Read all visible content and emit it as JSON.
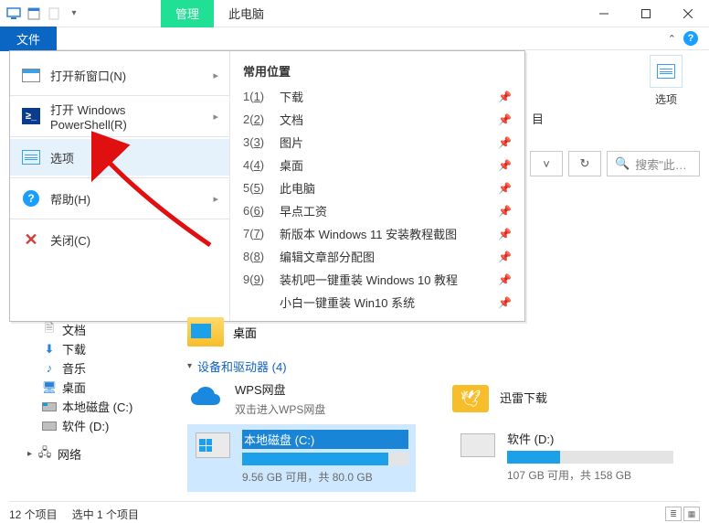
{
  "titlebar": {
    "tab_manage": "管理",
    "tab_thispc": "此电脑"
  },
  "ribbon": {
    "file_tab": "文件",
    "options_tile_label": "选项"
  },
  "remnant_label": "目",
  "search": {
    "placeholder": "搜索\"此…"
  },
  "file_menu": {
    "left": {
      "new_window": "打开新窗口(N)",
      "powershell": "打开 Windows PowerShell(R)",
      "options": "选项",
      "help": "帮助(H)",
      "close": "关闭(C)"
    },
    "right_heading": "常用位置",
    "locations": [
      {
        "num": "1",
        "label": "下载"
      },
      {
        "num": "2",
        "label": "文档"
      },
      {
        "num": "3",
        "label": "图片"
      },
      {
        "num": "4",
        "label": "桌面"
      },
      {
        "num": "5",
        "label": "此电脑"
      },
      {
        "num": "6",
        "label": "早点工资"
      },
      {
        "num": "7",
        "label": "新版本 Windows 11 安装教程截图"
      },
      {
        "num": "8",
        "label": "编辑文章部分配图"
      },
      {
        "num": "9",
        "label": "装机吧一键重装 Windows 10 教程"
      },
      {
        "num": "",
        "label": "小白一键重装 Win10 系统"
      }
    ]
  },
  "sidebar": {
    "items": [
      {
        "label": "文档"
      },
      {
        "label": "下载"
      },
      {
        "label": "音乐"
      },
      {
        "label": "桌面"
      },
      {
        "label": "本地磁盘 (C:)"
      },
      {
        "label": "软件 (D:)"
      },
      {
        "label": "网络"
      }
    ]
  },
  "content": {
    "desktop_label": "桌面",
    "section_devices": "设备和驱动器 (4)",
    "wps": {
      "name": "WPS网盘",
      "sub": "双击进入WPS网盘"
    },
    "xunlei": {
      "name": "迅雷下载"
    },
    "drive_c": {
      "name": "本地磁盘 (C:)",
      "sub": "9.56 GB 可用，共 80.0 GB"
    },
    "drive_d": {
      "name": "软件 (D:)",
      "sub": "107 GB 可用，共 158 GB"
    }
  },
  "statusbar": {
    "count": "12 个项目",
    "selection": "选中 1 个项目"
  }
}
